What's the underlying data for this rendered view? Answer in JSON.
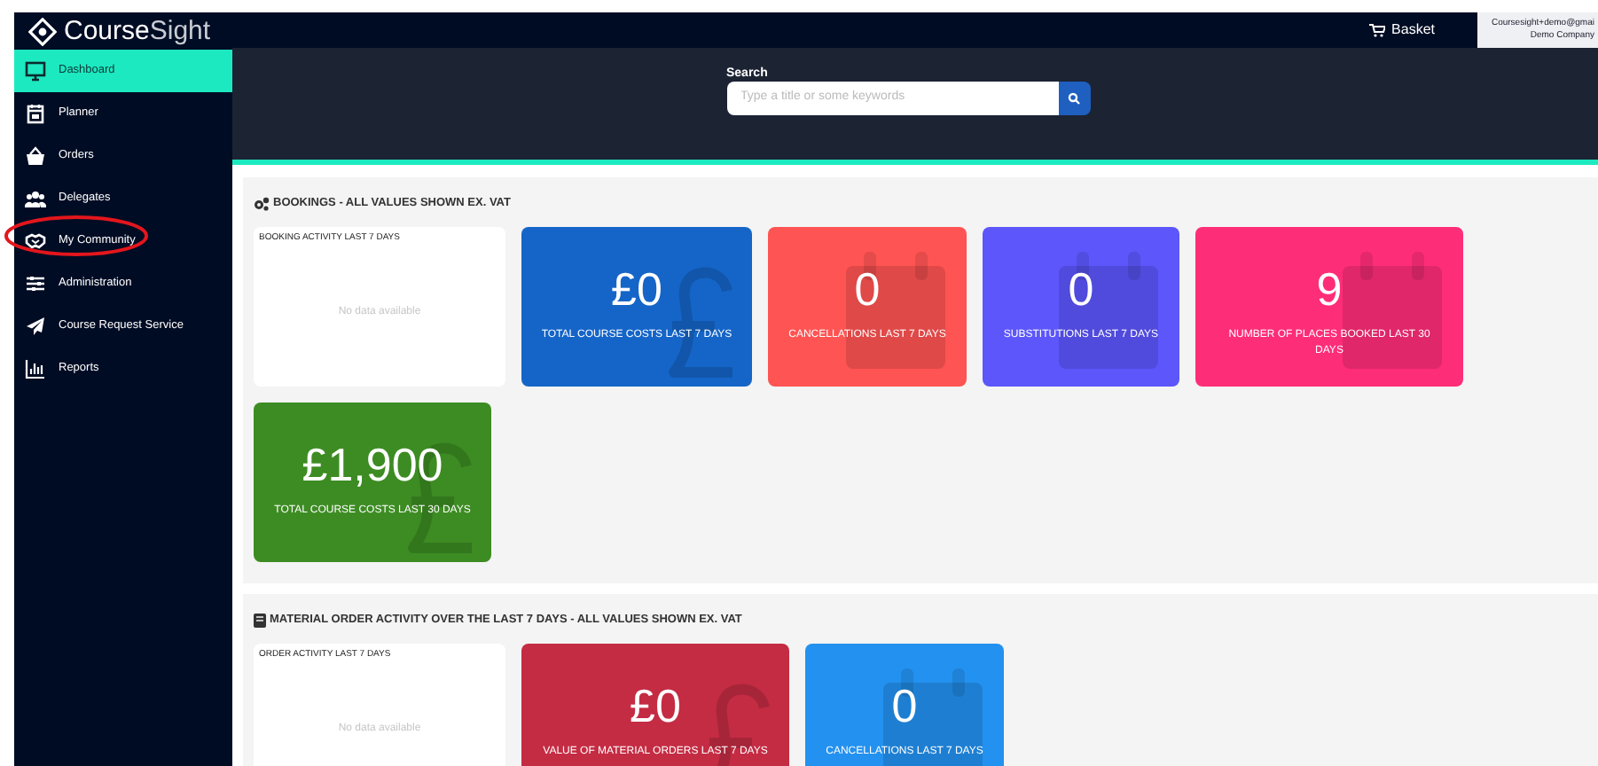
{
  "logo": {
    "text_main": "Course",
    "text_accent": "Sight"
  },
  "sidebar": {
    "items": [
      {
        "label": "Dashboard",
        "selected": true
      },
      {
        "label": "Planner",
        "selected": false
      },
      {
        "label": "Orders",
        "selected": false
      },
      {
        "label": "Delegates",
        "selected": false
      },
      {
        "label": "My Community",
        "selected": false,
        "annotated": true
      },
      {
        "label": "Administration",
        "selected": false
      },
      {
        "label": "Course Request Service",
        "selected": false
      },
      {
        "label": "Reports",
        "selected": false
      }
    ]
  },
  "header": {
    "basket": "Basket",
    "user_email": "Coursesight+demo@gmai",
    "user_company": "Demo Company"
  },
  "search": {
    "label": "Search",
    "placeholder": "Type a title or some keywords"
  },
  "sections": [
    {
      "title": "BOOKINGS - ALL VALUES SHOWN EX. VAT",
      "chart_title": "BOOKING ACTIVITY LAST 7 DAYS",
      "chart_empty": "No data available",
      "tiles": [
        {
          "value": "£0",
          "label": "TOTAL COURSE COSTS LAST 7 DAYS",
          "kind": "currency",
          "color": "#1565c8"
        },
        {
          "value": "0",
          "label": "CANCELLATIONS LAST 7 DAYS",
          "kind": "calendar",
          "color": "#fe5453"
        },
        {
          "value": "0",
          "label": "SUBSTITUTIONS LAST 7 DAYS",
          "kind": "calendar",
          "color": "#5c56fb"
        },
        {
          "value": "9",
          "label": "NUMBER OF PLACES BOOKED LAST 30 DAYS",
          "kind": "calendar",
          "color": "#fe2d78"
        },
        {
          "value": "£1,900",
          "label": "TOTAL COURSE COSTS LAST 30 DAYS",
          "kind": "currency",
          "color": "#3d8c23"
        }
      ]
    },
    {
      "title": "MATERIAL ORDER ACTIVITY OVER THE LAST 7 DAYS - ALL VALUES SHOWN EX. VAT",
      "chart_title": "ORDER ACTIVITY LAST 7 DAYS",
      "chart_empty": "No data available",
      "tiles": [
        {
          "value": "£0",
          "label": "VALUE OF MATERIAL ORDERS LAST 7 DAYS",
          "kind": "currency",
          "color": "#c42c43"
        },
        {
          "value": "0",
          "label": "CANCELLATIONS LAST 7 DAYS",
          "kind": "calendar",
          "color": "#2391ef"
        }
      ]
    }
  ]
}
